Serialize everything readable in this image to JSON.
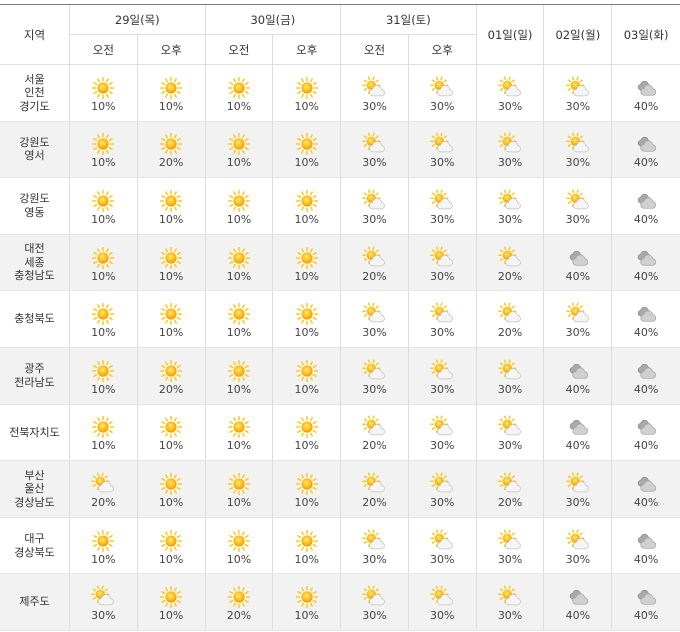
{
  "header": {
    "region": "지역",
    "days": [
      {
        "label": "29일(목)",
        "periods": [
          "오전",
          "오후"
        ]
      },
      {
        "label": "30일(금)",
        "periods": [
          "오전",
          "오후"
        ]
      },
      {
        "label": "31일(토)",
        "periods": [
          "오전",
          "오후"
        ]
      },
      {
        "label": "01일(일)",
        "periods": []
      },
      {
        "label": "02일(월)",
        "periods": []
      },
      {
        "label": "03일(화)",
        "periods": []
      }
    ]
  },
  "rows": [
    {
      "region": [
        "서울",
        "인천",
        "경기도"
      ],
      "cells": [
        {
          "icon": "sunny",
          "pop": "10%"
        },
        {
          "icon": "sunny",
          "pop": "10%"
        },
        {
          "icon": "sunny",
          "pop": "10%"
        },
        {
          "icon": "sunny",
          "pop": "10%"
        },
        {
          "icon": "partly-cloudy",
          "pop": "30%"
        },
        {
          "icon": "partly-cloudy",
          "pop": "30%"
        },
        {
          "icon": "partly-cloudy",
          "pop": "30%"
        },
        {
          "icon": "partly-cloudy",
          "pop": "30%"
        },
        {
          "icon": "cloudy",
          "pop": "40%"
        }
      ]
    },
    {
      "region": [
        "강원도",
        "영서"
      ],
      "cells": [
        {
          "icon": "sunny",
          "pop": "10%"
        },
        {
          "icon": "sunny",
          "pop": "20%"
        },
        {
          "icon": "sunny",
          "pop": "10%"
        },
        {
          "icon": "sunny",
          "pop": "10%"
        },
        {
          "icon": "partly-cloudy",
          "pop": "30%"
        },
        {
          "icon": "partly-cloudy",
          "pop": "30%"
        },
        {
          "icon": "partly-cloudy",
          "pop": "30%"
        },
        {
          "icon": "partly-cloudy",
          "pop": "30%"
        },
        {
          "icon": "cloudy",
          "pop": "40%"
        }
      ]
    },
    {
      "region": [
        "강원도",
        "영동"
      ],
      "cells": [
        {
          "icon": "sunny",
          "pop": "10%"
        },
        {
          "icon": "sunny",
          "pop": "10%"
        },
        {
          "icon": "sunny",
          "pop": "10%"
        },
        {
          "icon": "sunny",
          "pop": "10%"
        },
        {
          "icon": "partly-cloudy",
          "pop": "30%"
        },
        {
          "icon": "partly-cloudy",
          "pop": "30%"
        },
        {
          "icon": "partly-cloudy",
          "pop": "30%"
        },
        {
          "icon": "partly-cloudy",
          "pop": "30%"
        },
        {
          "icon": "cloudy",
          "pop": "40%"
        }
      ]
    },
    {
      "region": [
        "대전",
        "세종",
        "충청남도"
      ],
      "cells": [
        {
          "icon": "sunny",
          "pop": "10%"
        },
        {
          "icon": "sunny",
          "pop": "10%"
        },
        {
          "icon": "sunny",
          "pop": "10%"
        },
        {
          "icon": "sunny",
          "pop": "10%"
        },
        {
          "icon": "partly-cloudy",
          "pop": "20%"
        },
        {
          "icon": "partly-cloudy",
          "pop": "30%"
        },
        {
          "icon": "partly-cloudy",
          "pop": "20%"
        },
        {
          "icon": "cloudy",
          "pop": "40%"
        },
        {
          "icon": "cloudy",
          "pop": "40%"
        }
      ]
    },
    {
      "region": [
        "충청북도"
      ],
      "cells": [
        {
          "icon": "sunny",
          "pop": "10%"
        },
        {
          "icon": "sunny",
          "pop": "10%"
        },
        {
          "icon": "sunny",
          "pop": "10%"
        },
        {
          "icon": "sunny",
          "pop": "10%"
        },
        {
          "icon": "partly-cloudy",
          "pop": "30%"
        },
        {
          "icon": "partly-cloudy",
          "pop": "30%"
        },
        {
          "icon": "partly-cloudy",
          "pop": "20%"
        },
        {
          "icon": "partly-cloudy",
          "pop": "30%"
        },
        {
          "icon": "cloudy",
          "pop": "40%"
        }
      ]
    },
    {
      "region": [
        "광주",
        "전라남도"
      ],
      "cells": [
        {
          "icon": "sunny",
          "pop": "10%"
        },
        {
          "icon": "sunny",
          "pop": "20%"
        },
        {
          "icon": "sunny",
          "pop": "10%"
        },
        {
          "icon": "sunny",
          "pop": "10%"
        },
        {
          "icon": "partly-cloudy",
          "pop": "30%"
        },
        {
          "icon": "partly-cloudy",
          "pop": "30%"
        },
        {
          "icon": "partly-cloudy",
          "pop": "30%"
        },
        {
          "icon": "cloudy",
          "pop": "40%"
        },
        {
          "icon": "cloudy",
          "pop": "40%"
        }
      ]
    },
    {
      "region": [
        "전북자치도"
      ],
      "cells": [
        {
          "icon": "sunny",
          "pop": "10%"
        },
        {
          "icon": "sunny",
          "pop": "10%"
        },
        {
          "icon": "sunny",
          "pop": "10%"
        },
        {
          "icon": "sunny",
          "pop": "10%"
        },
        {
          "icon": "partly-cloudy",
          "pop": "20%"
        },
        {
          "icon": "partly-cloudy",
          "pop": "30%"
        },
        {
          "icon": "partly-cloudy",
          "pop": "30%"
        },
        {
          "icon": "cloudy",
          "pop": "40%"
        },
        {
          "icon": "cloudy",
          "pop": "40%"
        }
      ]
    },
    {
      "region": [
        "부산",
        "울산",
        "경상남도"
      ],
      "cells": [
        {
          "icon": "partly-cloudy",
          "pop": "20%"
        },
        {
          "icon": "sunny",
          "pop": "10%"
        },
        {
          "icon": "sunny",
          "pop": "10%"
        },
        {
          "icon": "sunny",
          "pop": "10%"
        },
        {
          "icon": "partly-cloudy",
          "pop": "20%"
        },
        {
          "icon": "partly-cloudy",
          "pop": "30%"
        },
        {
          "icon": "partly-cloudy",
          "pop": "20%"
        },
        {
          "icon": "partly-cloudy",
          "pop": "30%"
        },
        {
          "icon": "cloudy",
          "pop": "40%"
        }
      ]
    },
    {
      "region": [
        "대구",
        "경상북도"
      ],
      "cells": [
        {
          "icon": "sunny",
          "pop": "10%"
        },
        {
          "icon": "sunny",
          "pop": "10%"
        },
        {
          "icon": "sunny",
          "pop": "10%"
        },
        {
          "icon": "sunny",
          "pop": "10%"
        },
        {
          "icon": "partly-cloudy",
          "pop": "30%"
        },
        {
          "icon": "partly-cloudy",
          "pop": "30%"
        },
        {
          "icon": "partly-cloudy",
          "pop": "30%"
        },
        {
          "icon": "partly-cloudy",
          "pop": "30%"
        },
        {
          "icon": "cloudy",
          "pop": "40%"
        }
      ]
    },
    {
      "region": [
        "제주도"
      ],
      "cells": [
        {
          "icon": "partly-cloudy",
          "pop": "30%"
        },
        {
          "icon": "sunny",
          "pop": "10%"
        },
        {
          "icon": "sunny",
          "pop": "20%"
        },
        {
          "icon": "sunny",
          "pop": "10%"
        },
        {
          "icon": "partly-cloudy",
          "pop": "30%"
        },
        {
          "icon": "partly-cloudy",
          "pop": "30%"
        },
        {
          "icon": "partly-cloudy",
          "pop": "30%"
        },
        {
          "icon": "cloudy",
          "pop": "40%"
        },
        {
          "icon": "cloudy",
          "pop": "40%"
        }
      ]
    }
  ],
  "colors": {
    "alt_row": "#f2f2f2",
    "grid": "#dddddd",
    "top_rule": "#7d7d7d",
    "text": "#333333",
    "sun_ray": "#ffc81a"
  }
}
